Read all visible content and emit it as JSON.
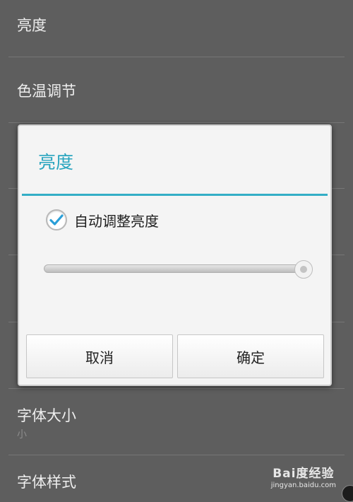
{
  "settings": {
    "items": [
      {
        "title": "亮度"
      },
      {
        "title": "色温调节"
      },
      {
        "title": "字体大小",
        "summary": "小"
      },
      {
        "title": "字体样式"
      }
    ]
  },
  "dialog": {
    "title": "亮度",
    "auto_brightness_label": "自动调整亮度",
    "auto_brightness_checked": true,
    "brightness_level": 0.99,
    "cancel_label": "取消",
    "ok_label": "确定"
  },
  "watermark": {
    "brand": "Bai度经验",
    "url": "jingyan.baidu.com"
  },
  "colors": {
    "accent": "#33aec6",
    "background": "#5e5e5e",
    "dialog_background": "#f4f4f4"
  }
}
